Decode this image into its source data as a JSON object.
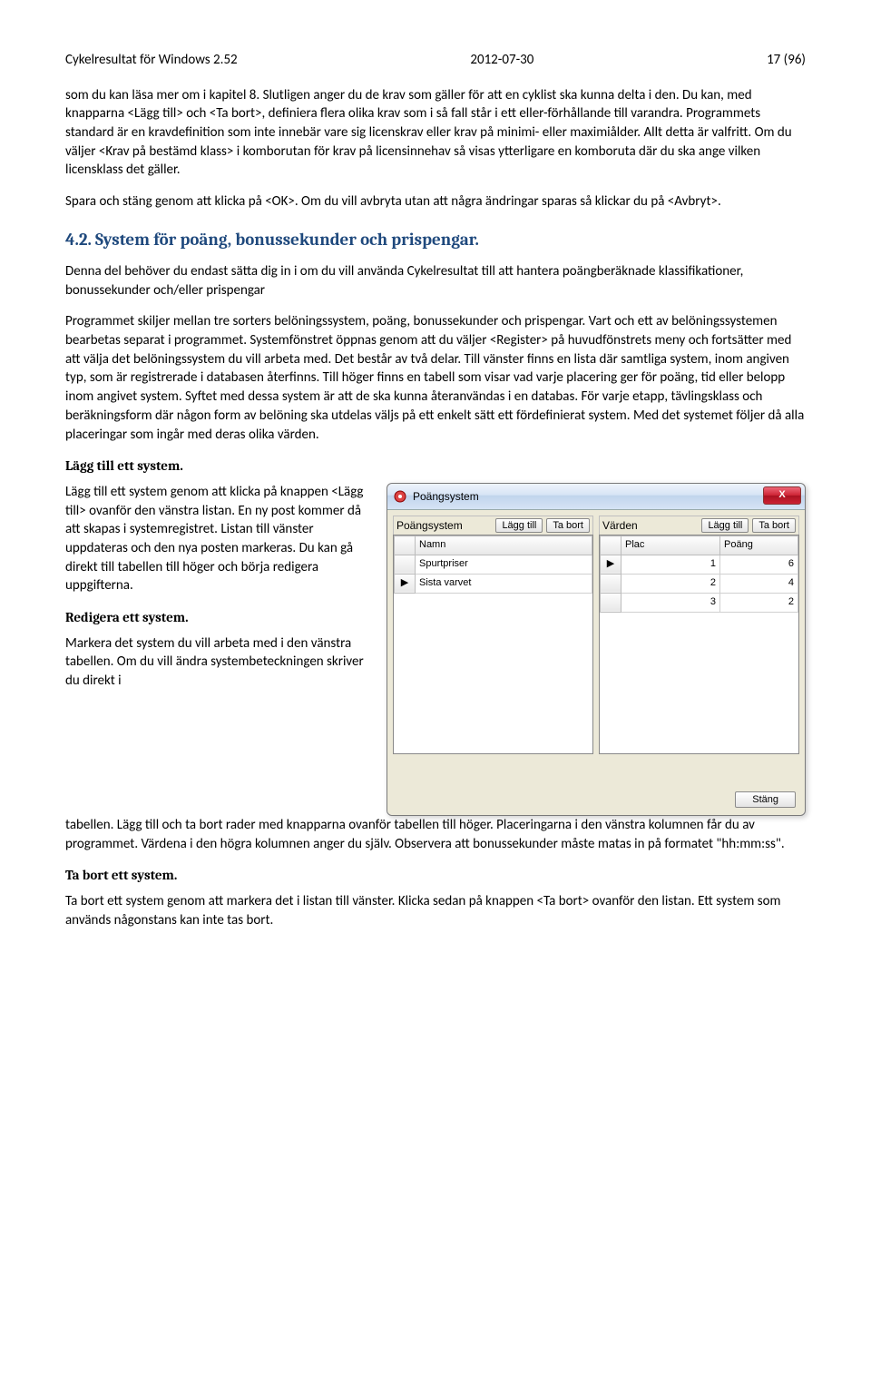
{
  "header": {
    "left": "Cykelresultat för Windows 2.52",
    "center": "2012-07-30",
    "right": "17 (96)"
  },
  "para1": "som du kan läsa mer om i kapitel 8. Slutligen anger du de krav som gäller för att en cyklist ska kunna delta i den. Du kan, med knapparna <Lägg till> och <Ta bort>, definiera flera olika krav som i så fall står i ett eller-förhållande till varandra. Programmets standard är en kravdefinition som inte innebär vare sig licenskrav eller krav på minimi- eller maximiålder. Allt detta är valfritt. Om du väljer <Krav på bestämd klass> i komborutan för krav på licensinnehav så visas ytterligare en komboruta där du ska ange vilken licensklass det gäller.",
  "para2": "Spara och stäng genom att klicka på <OK>. Om du vill avbryta utan att några ändringar sparas så klickar du på <Avbryt>.",
  "section_4_2": "4.2. System för poäng, bonussekunder och prispengar.",
  "para3": "Denna del behöver du endast sätta dig in i om du vill använda Cykelresultat till att hantera poängberäknade klassifikationer, bonussekunder och/eller prispengar",
  "para4": "Programmet skiljer mellan tre sorters belöningssystem, poäng, bonussekunder och prispengar. Vart och ett av belöningssystemen bearbetas separat i programmet. Systemfönstret öppnas genom att du väljer <Register> på huvudfönstrets meny och fortsätter med att välja det belöningssystem du vill arbeta med. Det består av två delar. Till vänster finns en lista där samtliga system, inom angiven typ, som är registrerade i databasen återfinns. Till höger finns en tabell som visar vad varje placering ger för poäng, tid eller belopp inom angivet system. Syftet med dessa system är att de ska kunna återanvändas i en databas. För varje etapp, tävlingsklass och beräkningsform där någon form av belöning ska utdelas väljs på ett enkelt sätt ett fördefinierat system. Med det systemet följer då alla placeringar som ingår med deras olika värden.",
  "h_add": "Lägg till ett system.",
  "para5": "Lägg till ett system genom att klicka på knappen <Lägg till> ovanför den vänstra listan. En ny post kommer då att skapas i systemregistret. Listan till vänster uppdateras och den nya posten markeras. Du kan gå direkt till tabellen till höger och börja redigera uppgifterna.",
  "h_edit": "Redigera ett system.",
  "para6a": "Markera det system du vill arbeta med i den vänstra tabellen. Om du vill ändra systembeteckningen skriver du direkt i",
  "para6b": "tabellen. Lägg till och ta bort rader med knapparna ovanför tabellen till höger. Placeringarna i den vänstra kolumnen får du av programmet. Värdena i den högra kolumnen anger du själv. Observera att bonussekunder måste matas in på formatet \"hh:mm:ss\".",
  "h_del": "Ta bort ett system.",
  "para7": "Ta bort ett system genom att markera det i listan till vänster. Klicka sedan på knappen <Ta bort> ovanför den listan. Ett system som används någonstans kan inte tas bort.",
  "dialog": {
    "title": "Poängsystem",
    "close_x": "X",
    "left": {
      "label": "Poängsystem",
      "btn_add": "Lägg till",
      "btn_del": "Ta bort",
      "col_name": "Namn",
      "rows": [
        {
          "name": "Spurtpriser"
        },
        {
          "name": "Sista varvet"
        }
      ]
    },
    "right": {
      "label": "Värden",
      "btn_add": "Lägg till",
      "btn_del": "Ta bort",
      "col_plac": "Plac",
      "col_poang": "Poäng",
      "rows": [
        {
          "plac": "1",
          "poang": "6"
        },
        {
          "plac": "2",
          "poang": "4"
        },
        {
          "plac": "3",
          "poang": "2"
        }
      ]
    },
    "btn_close": "Stäng"
  }
}
